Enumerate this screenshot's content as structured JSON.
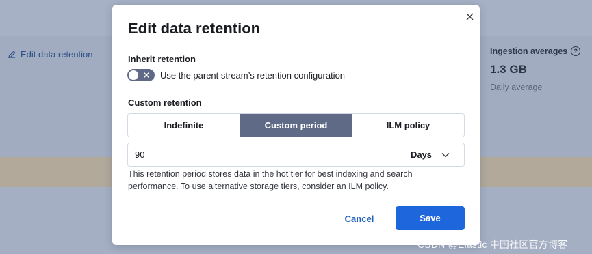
{
  "background": {
    "edit_link_label": "Edit data retention",
    "ingestion": {
      "title": "Ingestion averages",
      "value": "1.3 GB",
      "subtitle": "Daily average"
    }
  },
  "modal": {
    "title": "Edit data retention",
    "inherit": {
      "label": "Inherit retention",
      "toggle_text": "Use the parent stream’s retention configuration",
      "enabled": false
    },
    "custom": {
      "label": "Custom retention",
      "options": [
        "Indefinite",
        "Custom period",
        "ILM policy"
      ],
      "selected": "Custom period",
      "period_value": "90",
      "unit": "Days",
      "help_text": "This retention period stores data in the hot tier for best indexing and search performance. To use alternative storage tiers, consider an ILM policy."
    },
    "cancel_label": "Cancel",
    "save_label": "Save"
  },
  "watermark": "CSDN @Elastic 中国社区官方博客",
  "colors": {
    "accent": "#1e66dc",
    "segment_active": "#5f6b86",
    "link": "#1f5fbf"
  }
}
